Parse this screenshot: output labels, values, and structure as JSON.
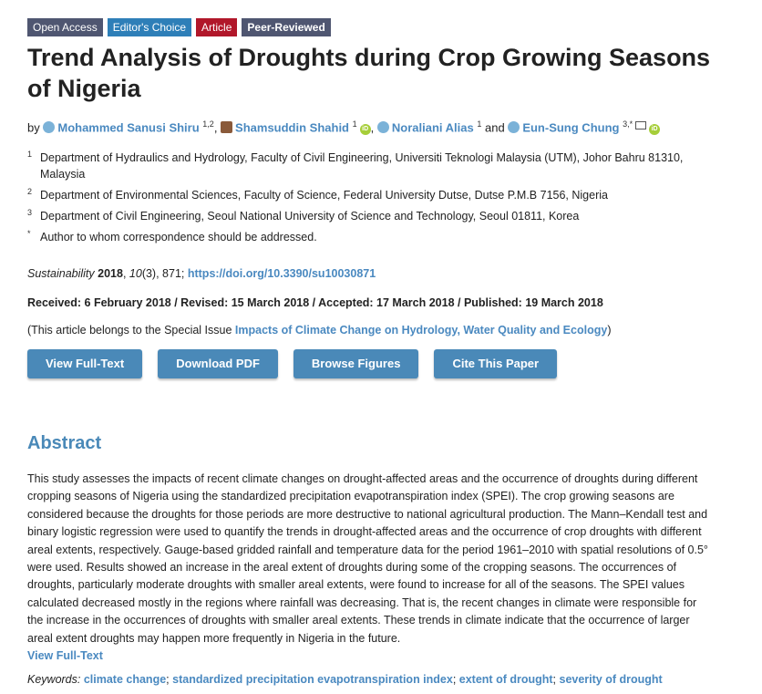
{
  "badges": [
    "Open Access",
    "Editor's Choice",
    "Article",
    "Peer-Reviewed"
  ],
  "title": "Trend Analysis of Droughts during Crop Growing Seasons of Nigeria",
  "authors": {
    "by": "by",
    "list": [
      {
        "name": "Mohammed Sanusi Shiru",
        "sup": "1,2"
      },
      {
        "name": "Shamsuddin Shahid",
        "sup": "1"
      },
      {
        "name": "Noraliani Alias",
        "sup": "1"
      },
      {
        "name": "Eun-Sung Chung",
        "sup": "3,*"
      }
    ],
    "and": "and",
    "orcid": "iD"
  },
  "affiliations": [
    {
      "num": "1",
      "text": "Department of Hydraulics and Hydrology, Faculty of Civil Engineering, Universiti Teknologi Malaysia (UTM), Johor Bahru 81310, Malaysia"
    },
    {
      "num": "2",
      "text": "Department of Environmental Sciences, Faculty of Science, Federal University Dutse, Dutse P.M.B 7156, Nigeria"
    },
    {
      "num": "3",
      "text": "Department of Civil Engineering, Seoul National University of Science and Technology, Seoul 01811, Korea"
    },
    {
      "num": "*",
      "text": "Author to whom correspondence should be addressed."
    }
  ],
  "citation": {
    "journal": "Sustainability",
    "year": "2018",
    "volume": "10",
    "issue": "(3), 871; ",
    "doi": "https://doi.org/10.3390/su10030871"
  },
  "dates": "Received: 6 February 2018 / Revised: 15 March 2018 / Accepted: 17 March 2018 / Published: 19 March 2018",
  "special_issue": {
    "prefix": "(This article belongs to the Special Issue ",
    "link": "Impacts of Climate Change on Hydrology, Water Quality and Ecology",
    "suffix": ")"
  },
  "buttons": [
    "View Full-Text",
    "Download PDF",
    "Browse Figures",
    "Cite This Paper"
  ],
  "abstract": {
    "heading": "Abstract",
    "text": "This study assesses the impacts of recent climate changes on drought-affected areas and the occurrence of droughts during different cropping seasons of Nigeria using the standardized precipitation evapotranspiration index (SPEI). The crop growing seasons are considered because the droughts for those periods are more destructive to national agricultural production. The Mann–Kendall test and binary logistic regression were used to quantify the trends in drought-affected areas and the occurrence of crop droughts with different areal extents, respectively. Gauge-based gridded rainfall and temperature data for the period 1961–2010 with spatial resolutions of 0.5° were used. Results showed an increase in the areal extent of droughts during some of the cropping seasons. The occurrences of droughts, particularly moderate droughts with smaller areal extents, were found to increase for all of the seasons. The SPEI values calculated decreased mostly in the regions where rainfall was decreasing. That is, the recent changes in climate were responsible for the increase in the occurrences of droughts with smaller areal extents. These trends in climate indicate that the occurrence of larger areal extent droughts may happen more frequently in Nigeria in the future.",
    "view_full_text": "View Full-Text"
  },
  "keywords": {
    "label": "Keywords:",
    "items": [
      "climate change",
      "standardized precipitation evapotranspiration index",
      "extent of drought",
      "severity of drought"
    ]
  },
  "colors": {
    "accent": "#4a89b8",
    "badge_dark": "#4f5671",
    "badge_blue": "#2e7fb8",
    "badge_red": "#b1172a"
  }
}
